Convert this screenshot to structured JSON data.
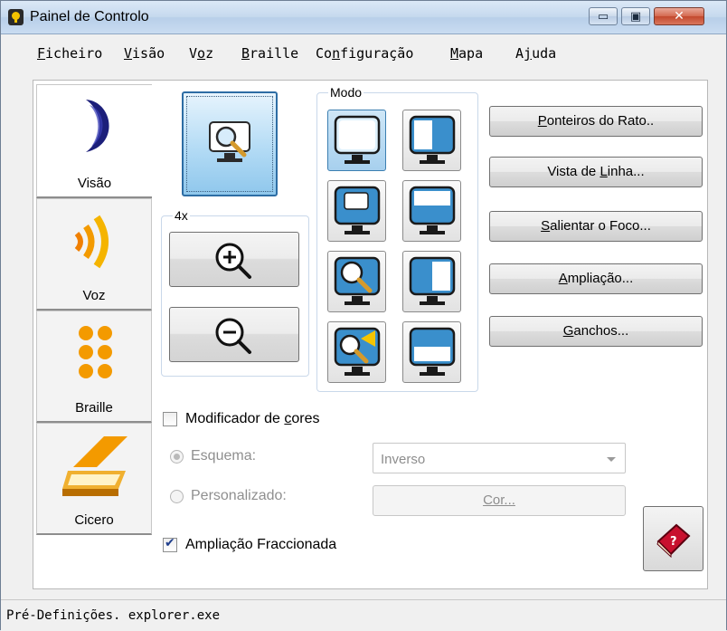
{
  "window": {
    "title": "Painel de Controlo",
    "minimize_glyph": "▭",
    "maximize_glyph": "▣",
    "close_glyph": "✕"
  },
  "menu": [
    {
      "label": "Ficheiro",
      "underline_index": 0
    },
    {
      "label": "Visão",
      "underline_index": 0
    },
    {
      "label": "Voz",
      "underline_index": 1
    },
    {
      "label": "Braille",
      "underline_index": 0
    },
    {
      "label": "Configuração",
      "underline_index": 2
    },
    {
      "label": "Mapa",
      "underline_index": 0
    },
    {
      "label": "Ajuda",
      "underline_index": 1
    }
  ],
  "sidebar": {
    "tabs": [
      {
        "label": "Visão",
        "icon": "moon-icon",
        "active": true
      },
      {
        "label": "Voz",
        "icon": "sound-waves-icon",
        "active": false
      },
      {
        "label": "Braille",
        "icon": "braille-cell-icon",
        "active": false
      },
      {
        "label": "Cicero",
        "icon": "scanner-icon",
        "active": false
      }
    ]
  },
  "zoom": {
    "level_label": "4x"
  },
  "mode": {
    "label": "Modo",
    "options": [
      "full-screen",
      "left-half",
      "small-window",
      "top-half",
      "magnifier-lens",
      "right-half",
      "locator",
      "bottom-half"
    ],
    "selected": "full-screen"
  },
  "buttons": {
    "mouse_pointers": {
      "label": "Ponteiros do Rato..",
      "underline_index": 0
    },
    "line_view": {
      "label": "Vista de Linha...",
      "underline_index": 9
    },
    "focus_highlight": {
      "label": "Salientar o Foco...",
      "underline_index": 0
    },
    "magnification": {
      "label": "Ampliação...",
      "underline_index": 0
    },
    "hooks": {
      "label": "Ganchos...",
      "underline_index": 0
    }
  },
  "color_modifier": {
    "label": "Modificador de cores",
    "checked": false,
    "scheme_label": "Esquema:",
    "scheme_value": "Inverso",
    "custom_label": "Personalizado:",
    "color_button": "Cor..."
  },
  "fractional_zoom": {
    "label": "Ampliação Fraccionada",
    "checked": true
  },
  "status": {
    "text": "Pré-Definições. explorer.exe"
  },
  "colors": {
    "accent": "#3c7fb1",
    "selected_tile": "#a7d0ee",
    "help_book": "#c8102e"
  }
}
